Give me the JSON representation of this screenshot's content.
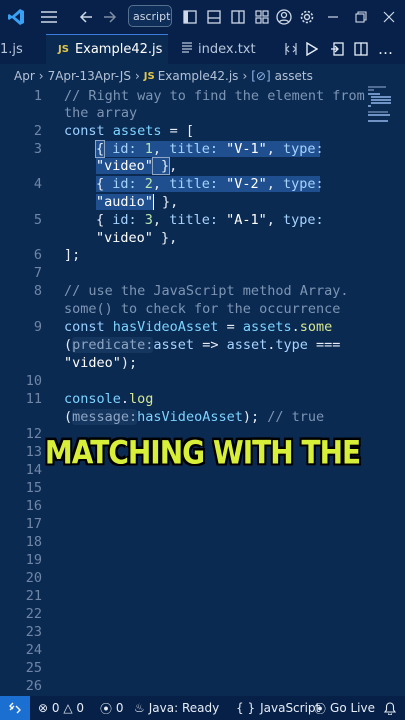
{
  "titlebar": {
    "search_value": "ascript P"
  },
  "tabs": [
    {
      "label": "1.js"
    },
    {
      "label": "Example42.js",
      "badge": "JS"
    },
    {
      "label": "index.txt"
    }
  ],
  "breadcrumb": {
    "part1": "Apr",
    "part2": "7Apr-13Apr-JS",
    "file_badge": "JS",
    "file": "Example42.js",
    "symbol": "assets"
  },
  "line_numbers": [
    "1",
    "2",
    "3",
    "4",
    "5",
    "6",
    "7",
    "8",
    "9",
    "10",
    "11",
    "12",
    "13",
    "14",
    "15",
    "16",
    "17",
    "18",
    "19",
    "20",
    "21",
    "22",
    "23",
    "24",
    "25",
    "26"
  ],
  "code": {
    "l1a": "// Right way to find the element from",
    "l1b": "the array",
    "l2": [
      "const",
      " assets",
      " = ["
    ],
    "l3a": [
      "{",
      " id:",
      " 1",
      ", ",
      "title:",
      " \"V-1\"",
      ", ",
      "type:"
    ],
    "l3b": [
      "\"video\"",
      " }",
      ","
    ],
    "l4a": [
      "{",
      " id:",
      " 2",
      ", ",
      "title:",
      " \"V-2\"",
      ", ",
      "type:"
    ],
    "l4b": [
      "\"audio\"",
      " }",
      ","
    ],
    "l5a": [
      "{",
      " id:",
      " 3",
      ", ",
      "title:",
      " \"A-1\"",
      ", ",
      "type:"
    ],
    "l5b": [
      "\"video\"",
      " }",
      ","
    ],
    "l6": "];",
    "l8a": "// use the JavaScript method Array.",
    "l8b": "some() to check for the occurrence",
    "l9a": [
      "const",
      " hasVideoAsset",
      " = ",
      "assets",
      ".",
      "some"
    ],
    "l9b": [
      "(",
      "predicate:",
      "asset",
      " => ",
      "asset",
      ".",
      "type",
      " ==="
    ],
    "l9c": [
      "\"video\"",
      ");"
    ],
    "l11a": [
      "console",
      ".",
      "log"
    ],
    "l11b": [
      "(",
      "message:",
      "hasVideoAsset",
      "); ",
      "// true"
    ]
  },
  "caption": "MATCHING WITH THE",
  "statusbar": {
    "errors": "0",
    "warnings": "0",
    "ports": "0",
    "java": "Java: Ready",
    "language": "JavaScript",
    "golive": "Go Live"
  }
}
